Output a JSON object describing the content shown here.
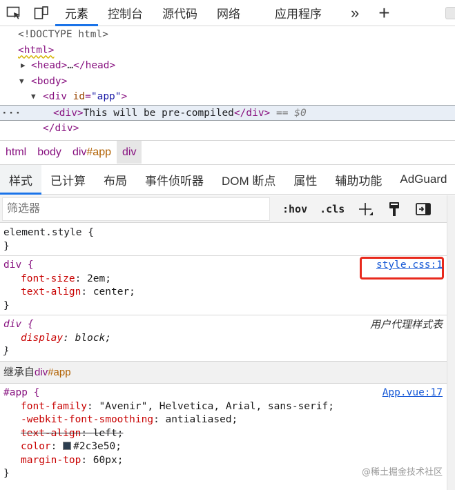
{
  "toolbar": {
    "tabs": [
      "元素",
      "控制台",
      "源代码",
      "网络",
      "应用程序"
    ],
    "more": "»",
    "add": "+"
  },
  "dom": {
    "doctype": "<!DOCTYPE html>",
    "html_open": "<html>",
    "head": {
      "open": "<head>",
      "ellipsis": "…",
      "close": "</head>"
    },
    "body": "<body>",
    "div_app": {
      "tag_open": "<div",
      "attr_name": "id",
      "attr_eq": "=",
      "attr_value": "\"app\"",
      "tag_close": ">"
    },
    "selected": {
      "open": "<div>",
      "text": "This will be pre-compiled",
      "close": "</div>",
      "eq": "== $0"
    },
    "div_close": "</div>"
  },
  "breadcrumbs": {
    "items": [
      "html",
      "body",
      "div",
      "#app",
      "div"
    ]
  },
  "panel_tabs": [
    "样式",
    "已计算",
    "布局",
    "事件侦听器",
    "DOM 断点",
    "属性",
    "辅助功能",
    "AdGuard"
  ],
  "filter": {
    "placeholder": "筛选器",
    "hov": ":hov",
    "cls": ".cls"
  },
  "styles": {
    "element_style": {
      "selector": "element.style {",
      "close": "}"
    },
    "div_rule": {
      "selector": "div {",
      "source": "style.css:1",
      "decls": [
        {
          "prop": "font-size",
          "value": "2em;"
        },
        {
          "prop": "text-align",
          "value": "center;"
        }
      ],
      "close": "}"
    },
    "ua_rule": {
      "selector": "div {",
      "label": "用户代理样式表",
      "decls": [
        {
          "prop": "display",
          "value": "block;"
        }
      ],
      "close": "}"
    },
    "inherited": {
      "prefix": "继承自",
      "tag": "div",
      "id": "#app"
    },
    "app_rule": {
      "selector": "#app {",
      "source": "App.vue:17",
      "decls": [
        {
          "prop": "font-family",
          "value": "\"Avenir\", Helvetica, Arial, sans-serif;",
          "struck": false
        },
        {
          "prop": "-webkit-font-smoothing",
          "value": "antialiased;",
          "struck": false
        },
        {
          "prop": "text-align",
          "value": "left;",
          "struck": true
        },
        {
          "prop": "color",
          "value": "#2c3e50;",
          "struck": false
        },
        {
          "prop": "margin-top",
          "value": "60px;",
          "struck": false
        }
      ],
      "close": "}"
    }
  },
  "colors": {
    "accent": "#1a73e8",
    "highlight": "#e8291c",
    "swatch": "#2c3e50"
  },
  "watermark": "@稀土掘金技术社区"
}
